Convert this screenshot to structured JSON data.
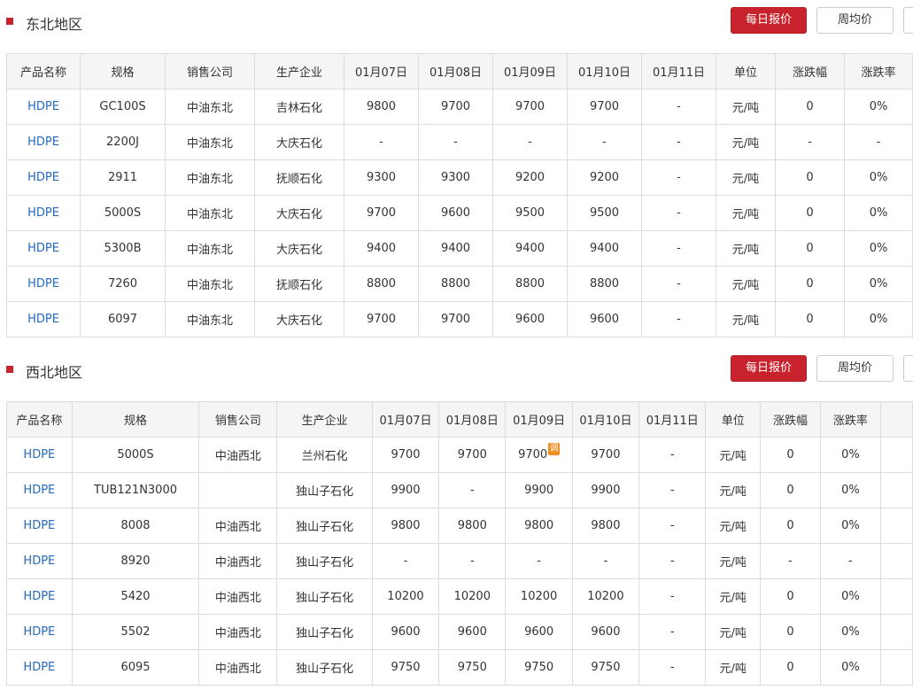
{
  "buttons": {
    "daily": "每日报价",
    "weekly": "周均价"
  },
  "adj_badge": "调",
  "sections": [
    {
      "title": "东北地区",
      "headers": [
        "产品名称",
        "规格",
        "销售公司",
        "生产企业",
        "01月07日",
        "01月08日",
        "01月09日",
        "01月10日",
        "01月11日",
        "单位",
        "涨跌幅",
        "涨跌率"
      ],
      "rows": [
        [
          "HDPE",
          "GC100S",
          "中油东北",
          "吉林石化",
          "9800",
          "9700",
          "9700",
          "9700",
          "-",
          "元/吨",
          "0",
          "0%"
        ],
        [
          "HDPE",
          "2200J",
          "中油东北",
          "大庆石化",
          "-",
          "-",
          "-",
          "-",
          "-",
          "元/吨",
          "-",
          "-"
        ],
        [
          "HDPE",
          "2911",
          "中油东北",
          "抚顺石化",
          "9300",
          "9300",
          "9200",
          "9200",
          "-",
          "元/吨",
          "0",
          "0%"
        ],
        [
          "HDPE",
          "5000S",
          "中油东北",
          "大庆石化",
          "9700",
          "9600",
          "9500",
          "9500",
          "-",
          "元/吨",
          "0",
          "0%"
        ],
        [
          "HDPE",
          "5300B",
          "中油东北",
          "大庆石化",
          "9400",
          "9400",
          "9400",
          "9400",
          "-",
          "元/吨",
          "0",
          "0%"
        ],
        [
          "HDPE",
          "7260",
          "中油东北",
          "抚顺石化",
          "8800",
          "8800",
          "8800",
          "8800",
          "-",
          "元/吨",
          "0",
          "0%"
        ],
        [
          "HDPE",
          "6097",
          "中油东北",
          "大庆石化",
          "9700",
          "9700",
          "9600",
          "9600",
          "-",
          "元/吨",
          "0",
          "0%"
        ]
      ]
    },
    {
      "title": "西北地区",
      "headers": [
        "产品名称",
        "规格",
        "销售公司",
        "生产企业",
        "01月07日",
        "01月08日",
        "01月09日",
        "01月10日",
        "01月11日",
        "单位",
        "涨跌幅",
        "涨跌率"
      ],
      "rows": [
        [
          "HDPE",
          "5000S",
          "中油西北",
          "兰州石化",
          "9700",
          "9700",
          "9700",
          "9700",
          "-",
          "元/吨",
          "0",
          "0%"
        ],
        [
          "HDPE",
          "TUB121N3000",
          "",
          "独山子石化",
          "9900",
          "-",
          "9900",
          "9900",
          "-",
          "元/吨",
          "0",
          "0%"
        ],
        [
          "HDPE",
          "8008",
          "中油西北",
          "独山子石化",
          "9800",
          "9800",
          "9800",
          "9800",
          "-",
          "元/吨",
          "0",
          "0%"
        ],
        [
          "HDPE",
          "8920",
          "中油西北",
          "独山子石化",
          "-",
          "-",
          "-",
          "-",
          "-",
          "元/吨",
          "-",
          "-"
        ],
        [
          "HDPE",
          "5420",
          "中油西北",
          "独山子石化",
          "10200",
          "10200",
          "10200",
          "10200",
          "-",
          "元/吨",
          "0",
          "0%"
        ],
        [
          "HDPE",
          "5502",
          "中油西北",
          "独山子石化",
          "9600",
          "9600",
          "9600",
          "9600",
          "-",
          "元/吨",
          "0",
          "0%"
        ],
        [
          "HDPE",
          "6095",
          "中油西北",
          "独山子石化",
          "9750",
          "9750",
          "9750",
          "9750",
          "-",
          "元/吨",
          "0",
          "0%"
        ]
      ]
    }
  ]
}
